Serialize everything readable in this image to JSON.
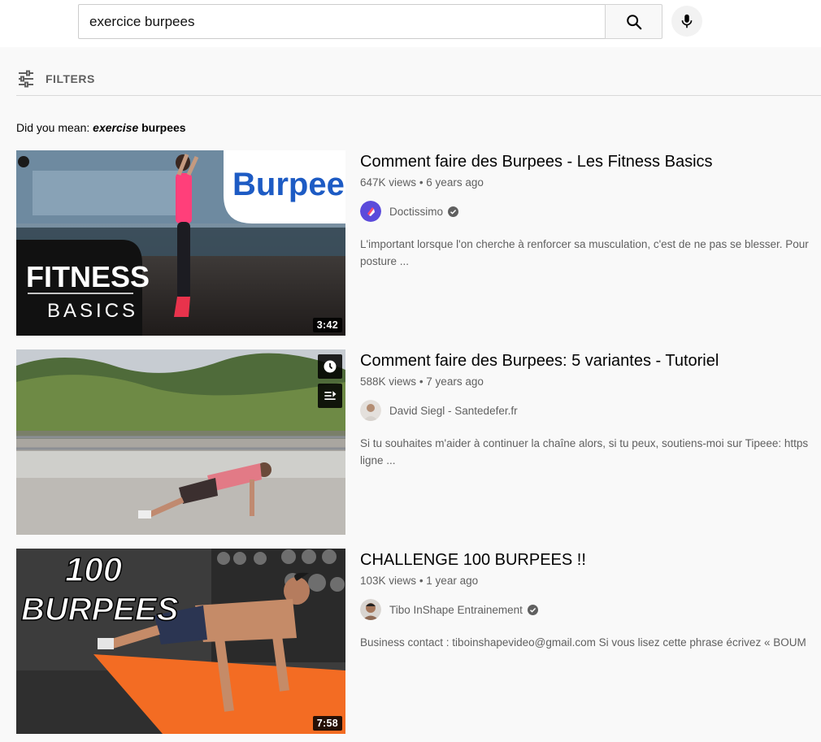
{
  "search": {
    "query": "exercice burpees",
    "search_button_icon": "search-icon",
    "mic_icon": "microphone-icon"
  },
  "filters": {
    "label": "FILTERS",
    "icon": "filter-sliders-icon"
  },
  "did_you_mean": {
    "prefix": "Did you mean:",
    "suggestion_italic": "exercise",
    "suggestion_rest": "burpees"
  },
  "results": [
    {
      "title": "Comment faire des Burpees - Les Fitness Basics",
      "views": "647K views",
      "age": "6 years ago",
      "channel": "Doctissimo",
      "verified": true,
      "description_line1": "L'important lorsque l'on cherche à renforcer sa musculation, c'est de ne pas se blesser. Pour",
      "description_line2": "posture ...",
      "duration": "3:42",
      "thumb_text": {
        "title": "Burpees",
        "line1": "FITNESS",
        "line2": "BASICS"
      }
    },
    {
      "title": "Comment faire des Burpees: 5 variantes - Tutoriel",
      "views": "588K views",
      "age": "7 years ago",
      "channel": "David Siegl - Santedefer.fr",
      "verified": false,
      "description_line1": "Si tu souhaites m'aider à continuer la chaîne alors, si tu peux, soutiens-moi sur Tipeee: https",
      "description_line2": "ligne ...",
      "hover_icons": [
        "watch-later-clock-icon",
        "add-to-queue-icon"
      ]
    },
    {
      "title": "CHALLENGE 100 BURPEES !!",
      "views": "103K views",
      "age": "1 year ago",
      "channel": "Tibo InShape Entrainement",
      "verified": true,
      "description_line1": "Business contact : tiboinshapevideo@gmail.com Si vous lisez cette phrase écrivez « BOUM",
      "description_line2": "",
      "duration": "7:58",
      "thumb_text": {
        "line1": "100",
        "line2": "BURPEES"
      }
    }
  ],
  "colors": {
    "background": "#f9f9f9",
    "text_primary": "#030303",
    "text_secondary": "#606060",
    "doctissimo_brand": "#5b4bdb"
  }
}
